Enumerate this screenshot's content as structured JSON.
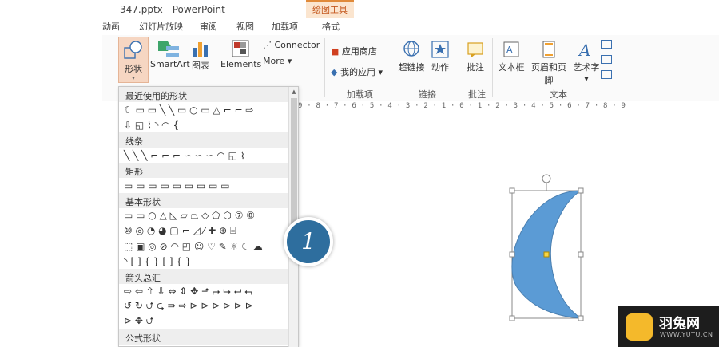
{
  "window": {
    "title": "347.pptx - PowerPoint",
    "tool_header": "绘图工具"
  },
  "tabs": [
    "动画",
    "幻灯片放映",
    "审阅",
    "视图",
    "加载项",
    "格式"
  ],
  "ribbon": {
    "shapes_label": "形状",
    "smartart_label": "SmartArt",
    "chart_label": "图表",
    "elements_label": "Elements",
    "connector_label": "Connector",
    "more_label": "More",
    "app_store_label": "应用商店",
    "my_apps_label": "我的应用",
    "addins_group": "加载项",
    "hyperlink_label": "超链接",
    "action_label": "动作",
    "links_group": "链接",
    "comment_label": "批注",
    "comments_group": "批注",
    "textbox_label": "文本框",
    "header_footer_label": "页眉和页脚",
    "wordart_label": "艺术字",
    "text_group": "文本"
  },
  "ruler_text": "9 · 8 · 7 · 6 · 5 · 4 · 3 · 2 · 1 · 0 · 1 · 2 · 3 · 4 · 5 · 6 · 7 · 8 · 9",
  "shape_panel": {
    "sections": [
      "最近使用的形状",
      "线条",
      "矩形",
      "基本形状",
      "箭头总汇",
      "公式形状"
    ],
    "rows": {
      "recent": [
        "☾ ▭ ▭ ╲ ╲ ▭ ○ ▭ △ ⌐ ⌐ ⇨",
        "⇩ ◱ ⌇ ◝ ◠ {"
      ],
      "lines": [
        "╲ ╲ ╲ ⌐ ⌐ ⌐ ∽ ∽ ∽ ◠ ◱ ⌇"
      ],
      "rect": [
        "▭ ▭ ▭ ▭ ▭ ▭ ▭ ▭ ▭"
      ],
      "basic": [
        "▭ ▭ ○ △ ◺ ▱ ⏢ ◇ ⬠ ⬡ ⑦ ⑧",
        "⑩ ◎ ◔ ◕ ▢ ⌐ ◿ ⁄ ✚ ⊕ ⌸",
        "⬚ ▣ ◎ ⊘ ◠ ◰ ☺ ♡ ✎ ☼ ☾ ☁",
        "◝ [ ] { } [ ] { }"
      ],
      "arrows": [
        "⇨ ⇦ ⇧ ⇩ ⇔ ⇕ ✥ ⬏ ⮣ ⮡ ⮠ ⮢",
        "↺ ↻ ⮍ ⮎ ⇛ ⇨ ⊳ ⊳ ⊳ ⊳ ⊳ ⊳",
        "⊳ ✥ ⮍"
      ],
      "equation": [
        "+ − × ÷ = ≠"
      ]
    }
  },
  "callout_number": "1",
  "watermark": {
    "name": "羽兔网",
    "url": "WWW.YUTU.CN"
  },
  "colors": {
    "accent": "#c4581e",
    "shape_fill": "#5b9bd5",
    "callout": "#2e6e9e"
  }
}
